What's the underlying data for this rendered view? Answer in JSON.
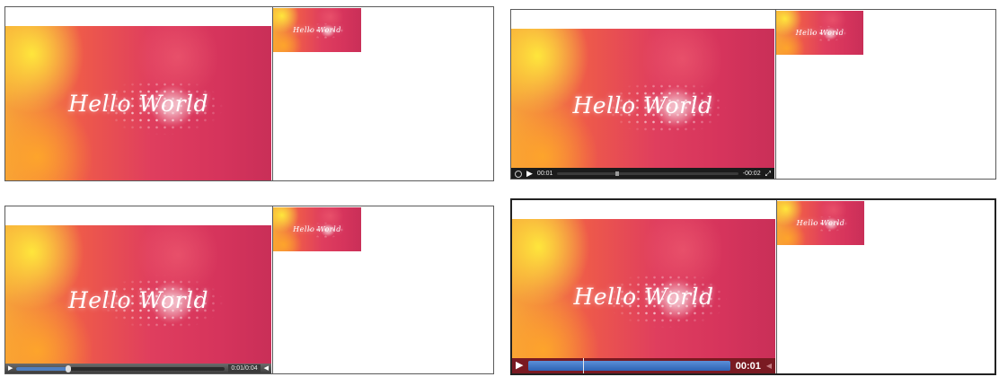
{
  "video_text": "Hello World",
  "panels": [
    {
      "label": "panel-1"
    },
    {
      "controls": {
        "elapsed": "00:01",
        "remaining": "-00:02",
        "progress": 0.33
      }
    },
    {
      "controls": {
        "time": "0:01/0:04",
        "progress": 0.25
      }
    },
    {
      "controls": {
        "elapsed": "00:01",
        "progress": 1.0,
        "cursor": 0.27
      }
    }
  ],
  "colors": {
    "video_pink": "#d6345c",
    "video_orange": "#f6a23a",
    "progress_blue": "#4f7fbf",
    "bar_maroon": "#7a1a22"
  }
}
